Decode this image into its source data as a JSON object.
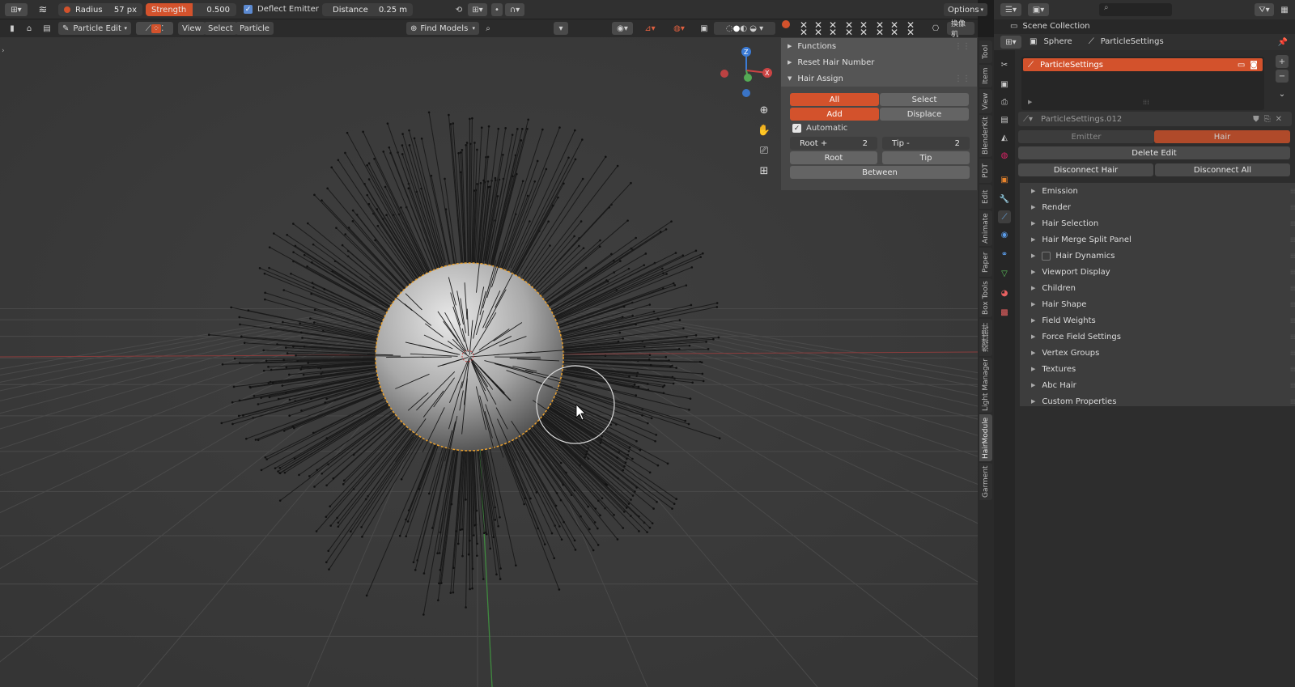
{
  "toolbar": {
    "radius_label": "Radius",
    "radius_value": "57 px",
    "strength_label": "Strength",
    "strength_value": "0.500",
    "deflect_label": "Deflect Emitter",
    "distance_label": "Distance",
    "distance_value": "0.25 m",
    "options_label": "Options"
  },
  "header": {
    "mode_label": "Particle Edit",
    "menus": [
      "View",
      "Select",
      "Particle"
    ],
    "find_models_label": "Find Models",
    "camera_label": "換像机"
  },
  "npanel": {
    "functions_label": "Functions",
    "reset_label": "Reset Hair Number",
    "hair_assign_label": "Hair Assign",
    "all_label": "All",
    "select_label": "Select",
    "add_label": "Add",
    "displace_label": "Displace",
    "automatic_label": "Automatic",
    "root_plus_label": "Root +",
    "root_plus_value": "2",
    "tip_minus_label": "Tip -",
    "tip_minus_value": "2",
    "root_label": "Root",
    "tip_label": "Tip",
    "between_label": "Between"
  },
  "vertical_tabs": [
    "Tool",
    "Item",
    "View",
    "BlenderKit",
    "PDT",
    "Edit",
    "Animate",
    "Paper",
    "Box Tools",
    "选择插件",
    "Light Manager",
    "HairModule",
    "Garment"
  ],
  "outliner": {
    "title": "Scene Collection"
  },
  "properties": {
    "breadcrumb_object": "Sphere",
    "breadcrumb_settings": "ParticleSettings",
    "list_item": "ParticleSettings",
    "datablock_name": "ParticleSettings.012",
    "emitter_label": "Emitter",
    "hair_label": "Hair",
    "delete_edit_label": "Delete Edit",
    "disconnect_hair_label": "Disconnect Hair",
    "disconnect_all_label": "Disconnect All",
    "sections": [
      "Emission",
      "Render",
      "Hair Selection",
      "Hair Merge Split Panel",
      "Hair Dynamics",
      "Viewport Display",
      "Children",
      "Hair Shape",
      "Field Weights",
      "Force Field Settings",
      "Vertex Groups",
      "Textures",
      "Abc Hair",
      "Custom Properties"
    ]
  },
  "colors": {
    "accent": "#d3522c",
    "selection_outline": "#e8a030"
  }
}
